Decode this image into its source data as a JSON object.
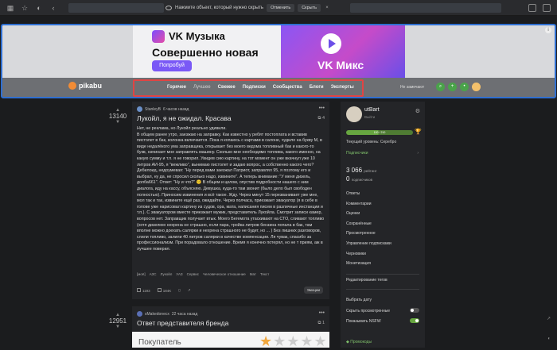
{
  "browser": {
    "notice": "Нажмите объект, который нужно скрыть",
    "notice_buttons": [
      "Отменить",
      "Скрыть"
    ]
  },
  "ad": {
    "brand": "VK Музыка",
    "headline": "Совершенно новая",
    "cta": "Попробуй",
    "right_title": "VK Микс"
  },
  "nav": {
    "logo": "pikabu",
    "items": [
      "Горячее",
      "Лучшее",
      "Свежее",
      "Подписки",
      "Сообщества",
      "Блоги",
      "Эксперты"
    ],
    "active_item": "Лучшее",
    "user_text": "Не замечают"
  },
  "post1": {
    "votes": "13140",
    "author": "StanleyB",
    "time": "6 часов назад",
    "title": "Лукойл, я не ожидал. Красава",
    "counter": "4",
    "paragraphs": [
      "Нет, не реклама, но Лукойл реально удивили.",
      "В общем ранее утро, заезжаю на заправку. Как известно у ребят постоплата и вставив пистолет в бак, колонка включается. Пока я копаюсь с картами в салоне, чудило на букву М, в виде недалёкого ума заправщика, открывает без моего ведома топливный бак и какого-то букв, начинает мне заправлять машину. Сколько мне необходимо топлива, какого именно, на какую сумму и т.п. я не говорил. Увидев сию картину, на тот момент он уже вкачнул уже 10 литров АИ-95, я \"вежливо\", вынимаю пистолет и задаю вопрос, а собственно какого чего? Дебилоид, недоумевая: \"Ну перед вами заезжал Патриот, заправлял 95, я поэтому его и выбрал, ну да, не спросил сколько надо, извините\". А теперь внимание: \"У меня дизель, долба661\". Ответ: \"Ну и что?\" 😑 В общем и целом, опустив подробности нашего с ним диалога, иду на кассу, объясняю. Девушка, куда-то там звонит (было дело был свободен полностью). Приносим извинения и всё такое. Жду. Через минут 15 перезванивает уже мне, мол так и так, извините ещё раз, ожидайте. Через полчаса, приезжает эвакуатор (я в себе в голове уже нарисовал картину из судов, ора, мата, написания писем в различные инстанции и т.п.). С эвакуатором вместе приезжает мужик, представитель Лукойла. Смотрит записи камер, вопросов нет. Заправщик получает втык. Моего Бегемота утаскивают на СТО, сливают топливо (хотя дизелюю нехрена не страшно, если пара, тройка литров бензина попала в бак, там вполне можно доехать салярки и нехрена страшного не будет, но ... ) Без лишних разговоров, слили топливо, залили 40 литров салярки в качестве компенсации. Ля чувак, спасибо за профессионализм. При порадовало отношение. Время я конечно потерял, но не т приям, аж в лучшее поверил."
    ],
    "tags": [
      "[моё]",
      "АЗС",
      "Лукойл",
      "УАЗ",
      "Сервис",
      "Человеческое отношение",
      "Мат",
      "Текст"
    ],
    "comments": "1193",
    "views": "184K",
    "emotions_label": "Эмоции"
  },
  "post2": {
    "votes": "12951",
    "author": "sMakedonecx",
    "time": "22 часа назад",
    "title": "Ответ представителя бренда",
    "counter": "1",
    "image_label": "Покупатель"
  },
  "sidebar": {
    "username": "utBart",
    "exit": "Выйти",
    "progress_text": "100 / 210",
    "progress": 0.48,
    "level": "Текущий уровень: Серебро",
    "followers": "Подписчики",
    "rating": "3 066",
    "rating_label": "рейтинг",
    "subs": "0",
    "subs_label": "подписчиков",
    "menu": [
      "Ответы",
      "Комментарии",
      "Оценки",
      "Сохранённые",
      "Просмотренное",
      "Управление подписками",
      "Черновики",
      "Монетизация"
    ],
    "edit_tags": "Редактирование тегов",
    "select_date": "Выбрать дату",
    "hide_viewed": "Скрыть просмотренные",
    "show_nsfw": "Показывать NSFW",
    "promo": "Промокоды"
  },
  "colors": {
    "selection_blue": "#2f6fd1",
    "selection_red": "#e04444",
    "green": "#67a640",
    "pikabu_orange": "#f28c36"
  }
}
